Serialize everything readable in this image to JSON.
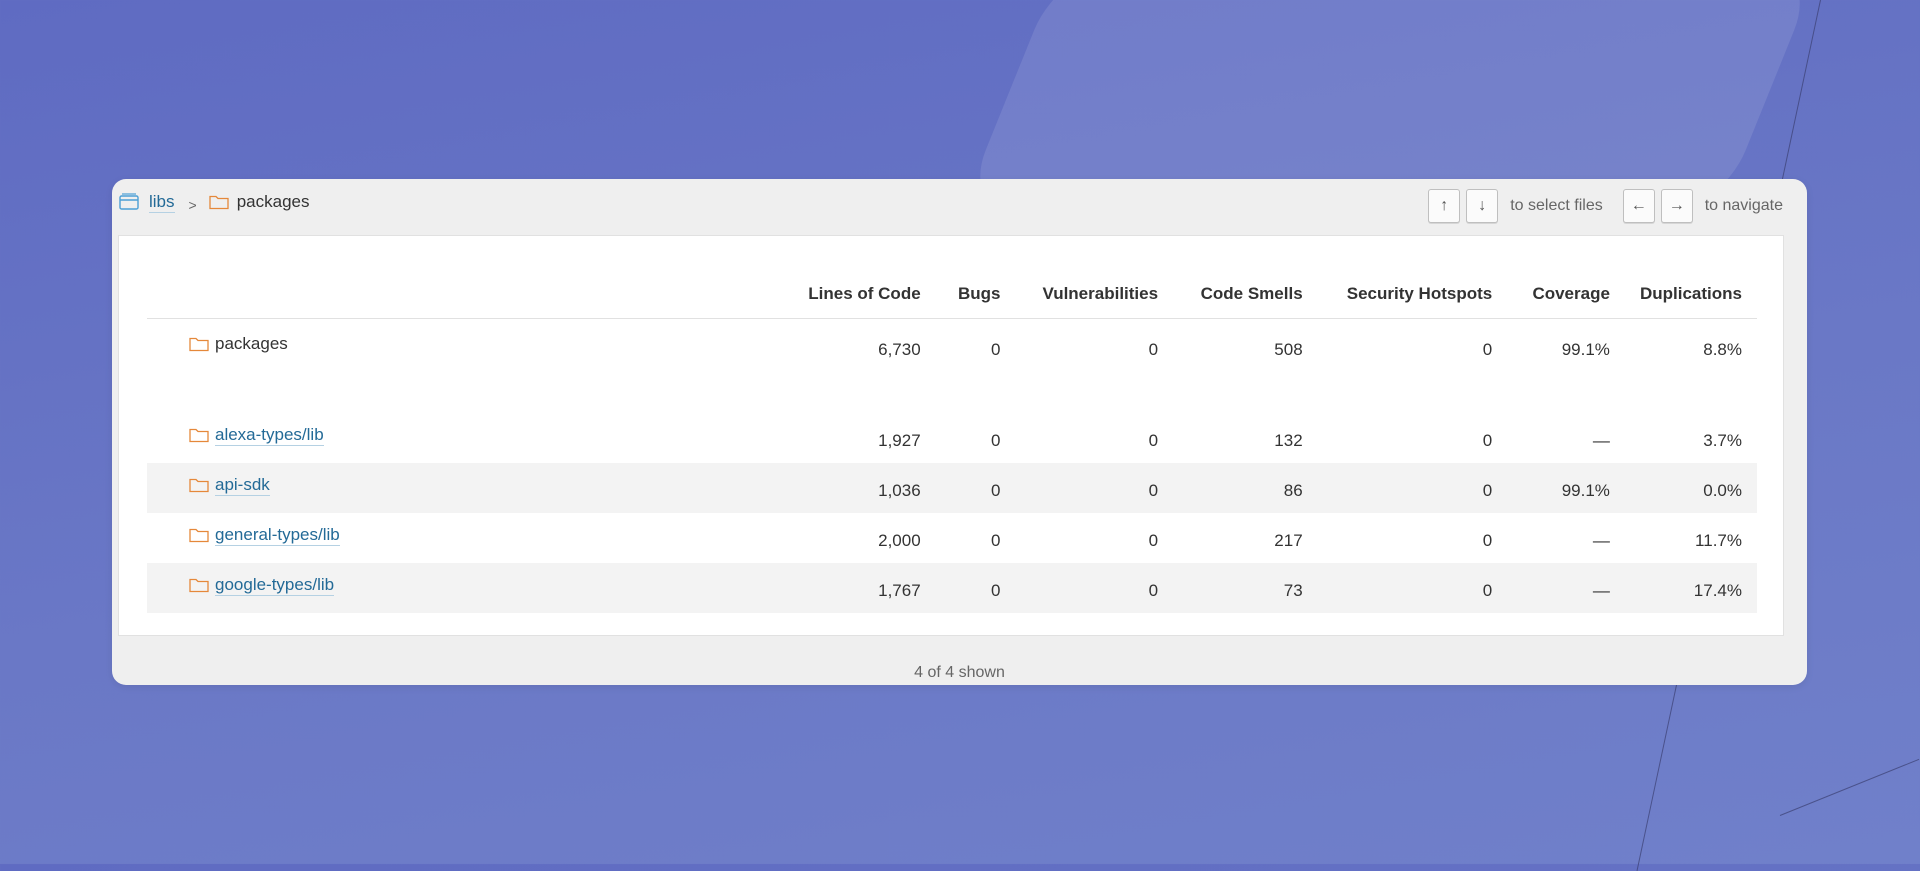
{
  "breadcrumb": {
    "root": "libs",
    "separator": ">",
    "current": "packages"
  },
  "shortcuts": {
    "up_key": "↑",
    "down_key": "↓",
    "select_hint": "to select files",
    "left_key": "←",
    "right_key": "→",
    "navigate_hint": "to navigate"
  },
  "columns": [
    "Lines of Code",
    "Bugs",
    "Vulnerabilities",
    "Code Smells",
    "Security Hotspots",
    "Coverage",
    "Duplications"
  ],
  "base_row": {
    "name": "packages",
    "values": [
      "6,730",
      "0",
      "0",
      "508",
      "0",
      "99.1%",
      "8.8%"
    ]
  },
  "rows": [
    {
      "name": "alexa-types/lib",
      "values": [
        "1,927",
        "0",
        "0",
        "132",
        "0",
        "—",
        "3.7%"
      ]
    },
    {
      "name": "api-sdk",
      "values": [
        "1,036",
        "0",
        "0",
        "86",
        "0",
        "99.1%",
        "0.0%"
      ]
    },
    {
      "name": "general-types/lib",
      "values": [
        "2,000",
        "0",
        "0",
        "217",
        "0",
        "—",
        "11.7%"
      ]
    },
    {
      "name": "google-types/lib",
      "values": [
        "1,767",
        "0",
        "0",
        "73",
        "0",
        "—",
        "17.4%"
      ]
    }
  ],
  "footer": "4 of 4 shown",
  "colors": {
    "link": "#236a97",
    "folder_icon": "#e5883a",
    "project_icon": "#4b9fd5"
  },
  "icons": {
    "root": "project-icon",
    "folder": "folder-icon"
  }
}
